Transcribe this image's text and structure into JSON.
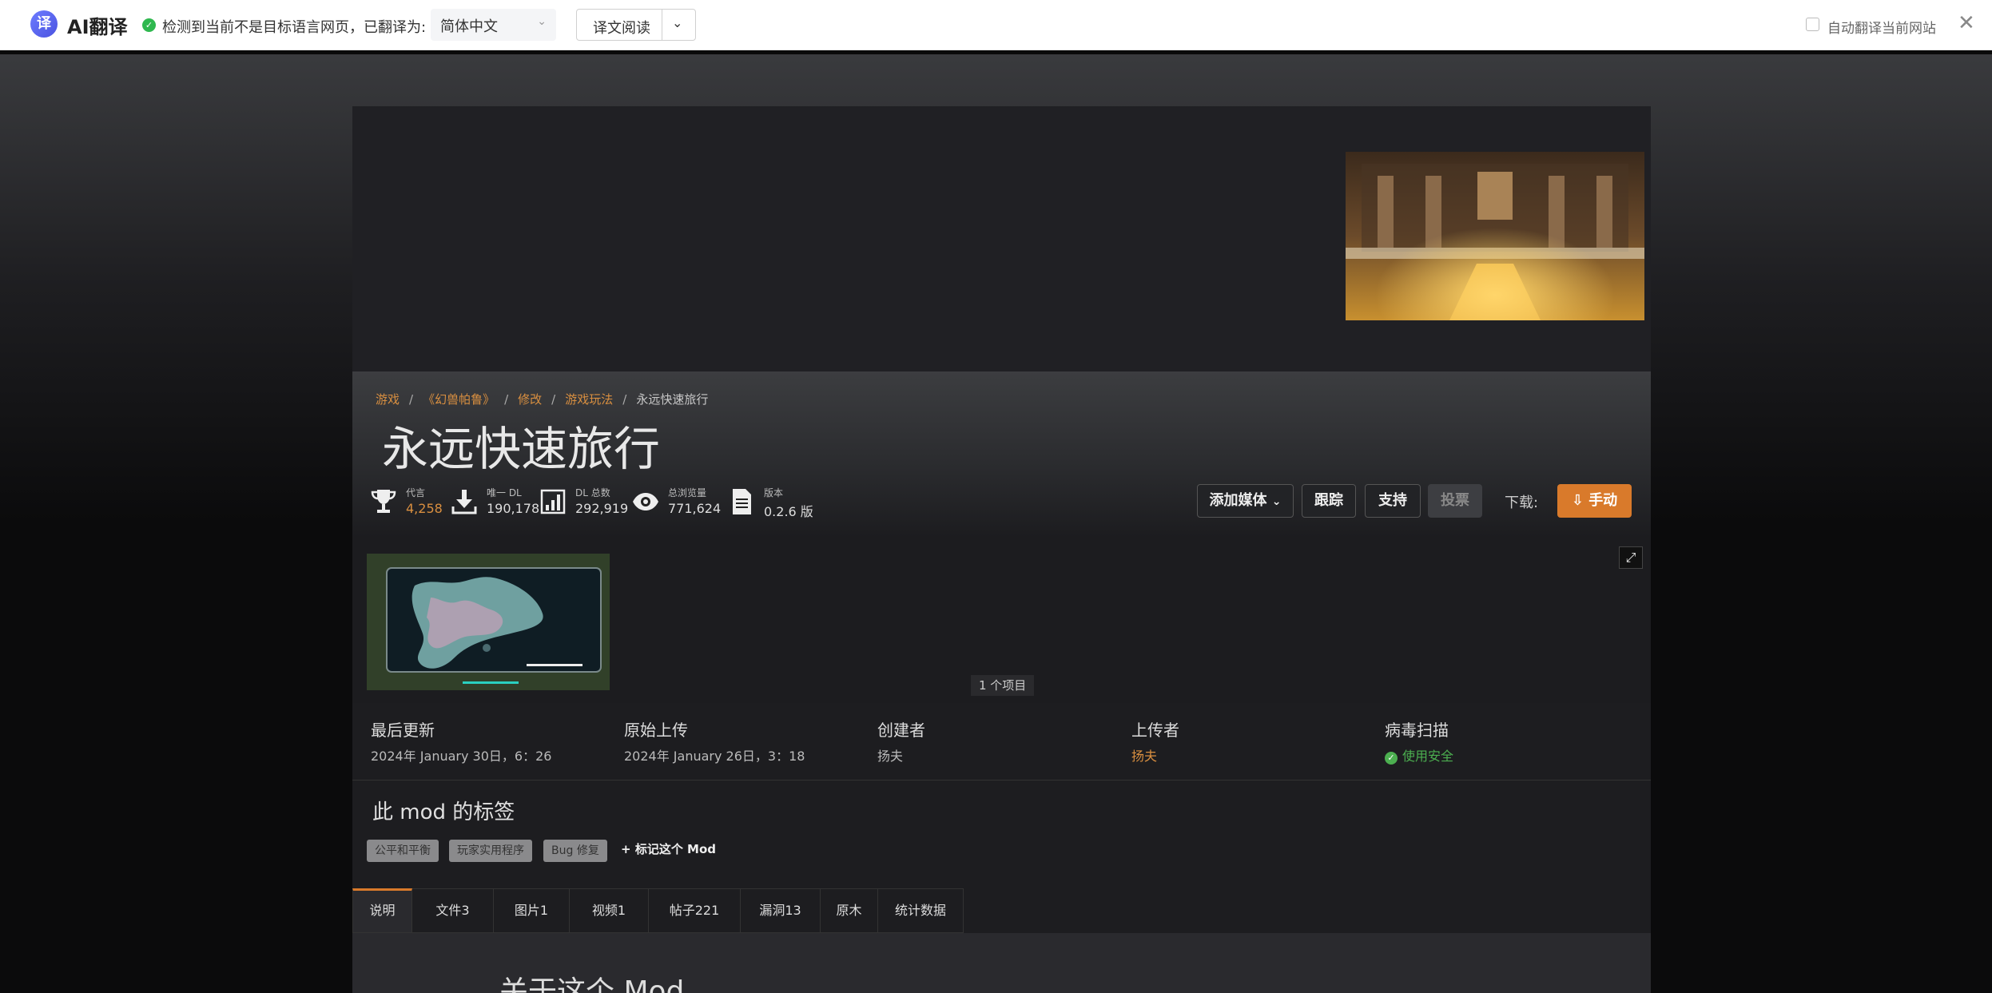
{
  "translate_bar": {
    "logo_glyph": "译",
    "brand": "AI翻译",
    "check_icon": "check-circle-icon",
    "message": "检测到当前不是目标语言网页，已翻译为:",
    "language": "简体中文",
    "read_button": "译文阅读",
    "auto_translate": "自动翻译当前网站",
    "close_glyph": "✕"
  },
  "breadcrumb": {
    "items": [
      "游戏",
      "《幻兽帕鲁》",
      "修改",
      "游戏玩法"
    ],
    "current": "永远快速旅行",
    "separator": "/"
  },
  "mod": {
    "title": "永远快速旅行"
  },
  "stats": [
    {
      "icon": "trophy-icon",
      "label": "代言",
      "value": "4,258",
      "accent": "#d98f40"
    },
    {
      "icon": "download-icon",
      "label": "唯一 DL",
      "value": "190,178"
    },
    {
      "icon": "bar-chart-icon",
      "label": "DL 总数",
      "value": "292,919"
    },
    {
      "icon": "eye-icon",
      "label": "总浏览量",
      "value": "771,624"
    },
    {
      "icon": "document-icon",
      "label": "版本",
      "value": "0.2.6 版"
    }
  ],
  "actions": {
    "add_media": "添加媒体",
    "track": "跟踪",
    "support": "支持",
    "vote": "投票",
    "download_label": "下载:",
    "manual": "手动"
  },
  "gallery": {
    "count": "1 个项目"
  },
  "meta": {
    "last_update": {
      "label": "最后更新",
      "value": "2024年 January 30日，6：26"
    },
    "original_upload": {
      "label": "原始上传",
      "value": "2024年 January 26日，3：18"
    },
    "creator": {
      "label": "创建者",
      "value": "扬夫"
    },
    "uploader": {
      "label": "上传者",
      "value": "扬夫"
    },
    "virus_scan": {
      "label": "病毒扫描",
      "value": "使用安全"
    }
  },
  "tags": {
    "heading": "此 mod 的标签",
    "items": [
      "公平和平衡",
      "玩家实用程序",
      "Bug 修复"
    ],
    "add": "标记这个 Mod"
  },
  "tabs": [
    "说明",
    "文件3",
    "图片1",
    "视频1",
    "帖子221",
    "漏洞13",
    "原木",
    "统计数据"
  ],
  "description": {
    "heading": "关于这个 Mod"
  },
  "colors": {
    "accent": "#d98f40",
    "button_orange": "#d97a2b",
    "safe_green": "#4caf50"
  }
}
